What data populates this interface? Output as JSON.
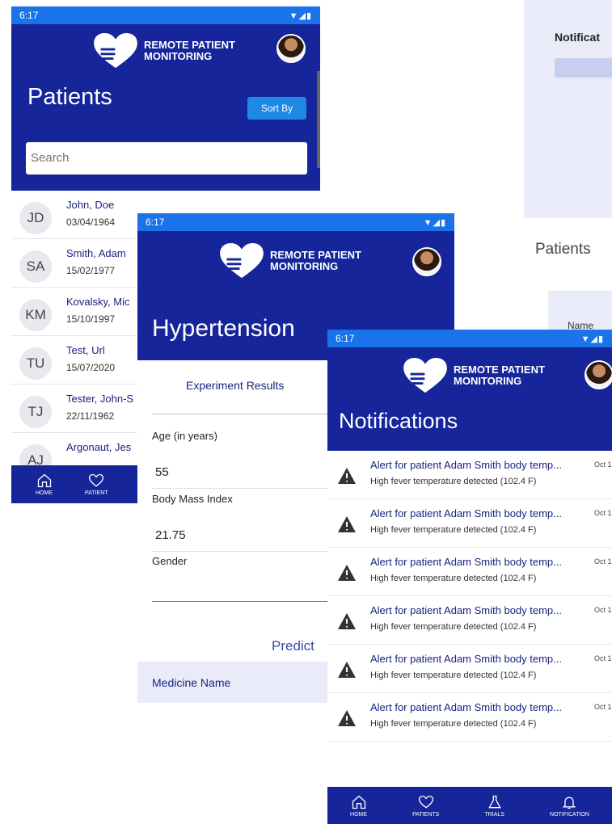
{
  "colors": {
    "primary": "#16259a",
    "status_bar": "#1a73e8",
    "accent": "#1e88e5",
    "link_text": "#1a237e"
  },
  "status": {
    "time": "6:17"
  },
  "brand": {
    "line1": "REMOTE PATIENT",
    "line2": "MONITORING",
    "icon": "heart-hand-icon"
  },
  "patients_screen": {
    "title": "Patients",
    "sort_label": "Sort By",
    "search_placeholder": "Search",
    "patients": [
      {
        "initials": "JD",
        "name": "John, Doe",
        "dob": "03/04/1964"
      },
      {
        "initials": "SA",
        "name": "Smith, Adam",
        "dob": "15/02/1977"
      },
      {
        "initials": "KM",
        "name": "Kovalsky, Mic",
        "dob": "15/10/1997"
      },
      {
        "initials": "TU",
        "name": "Test, Url",
        "dob": "15/07/2020"
      },
      {
        "initials": "TJ",
        "name": "Tester, John-S",
        "dob": "22/11/1962"
      },
      {
        "initials": "AJ",
        "name": "Argonaut, Jes",
        "dob": ""
      }
    ],
    "nav": {
      "home": "HOME",
      "patients": "PATIENT"
    }
  },
  "background_screen": {
    "notif_label": "Notificat",
    "patients_label": "Patients",
    "name_label": "Name"
  },
  "hypertension_screen": {
    "title": "Hypertension",
    "tab": "Experiment Results",
    "fields": [
      {
        "label": "Age (in years)",
        "value": "55"
      },
      {
        "label": "Body Mass Index",
        "value": "21.75"
      },
      {
        "label": "Gender",
        "value": ""
      }
    ],
    "predict_label": "Predict",
    "medicine_label": "Medicine Name"
  },
  "notifications_screen": {
    "title": "Notifications",
    "items": [
      {
        "title": "Alert for patient Adam Smith body temp...",
        "detail": "High fever temperature detected (102.4 F)",
        "date": "Oct 1"
      },
      {
        "title": "Alert for patient Adam Smith body temp...",
        "detail": "High fever temperature detected (102.4 F)",
        "date": "Oct 1"
      },
      {
        "title": "Alert for patient Adam Smith body temp...",
        "detail": "High fever temperature detected (102.4 F)",
        "date": "Oct 1"
      },
      {
        "title": "Alert for patient Adam Smith body temp...",
        "detail": "High fever temperature detected (102.4 F)",
        "date": "Oct 1"
      },
      {
        "title": "Alert for patient Adam Smith body temp...",
        "detail": "High fever temperature detected (102.4 F)",
        "date": "Oct 1"
      },
      {
        "title": "Alert for patient Adam Smith body temp...",
        "detail": "High fever temperature detected (102.4 F)",
        "date": "Oct 1"
      }
    ],
    "nav": {
      "home": "HOME",
      "patients": "PATIENTS",
      "trials": "TRIALS",
      "notifications": "NOTIFICATION"
    }
  }
}
